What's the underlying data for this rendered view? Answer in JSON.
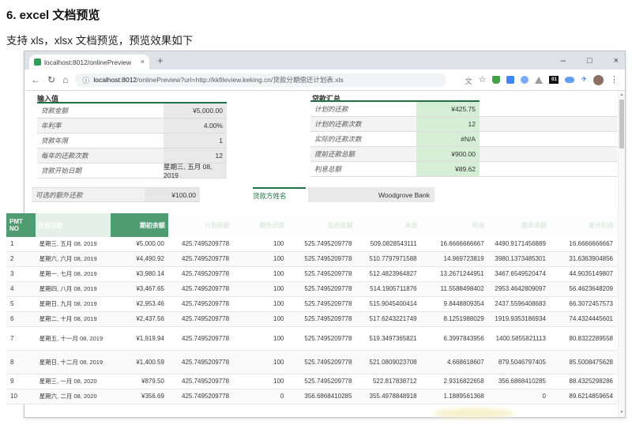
{
  "doc": {
    "title": "6. excel 文档预览",
    "subtitle": "支持 xls，xlsx 文档预览，预览效果如下"
  },
  "browser": {
    "tab_title": "localhost:8012/onlinePreview",
    "url_host": "localhost:8012",
    "url_rest": "/onlinePreview?url=http://kkfileview.keking.cn/贷款分期偿还计划表.xls",
    "extension_badge": "01"
  },
  "icons": {
    "back": "←",
    "refresh": "↻",
    "home": "⌂",
    "info": "ⓘ",
    "star": "☆",
    "translate": "文",
    "bird": "✈",
    "menu": "⋮",
    "minimize": "–",
    "maximize": "□",
    "close": "×",
    "tab_close": "×",
    "new_tab": "+",
    "scroll_up": "▲",
    "scroll_down": "▼"
  },
  "input_table": {
    "header": "输入值",
    "rows": [
      {
        "label": "贷款金额",
        "value": "¥5,000.00"
      },
      {
        "label": "年利率",
        "value": "4.00%"
      },
      {
        "label": "贷款年限",
        "value": "1"
      },
      {
        "label": "每年的还款次数",
        "value": "12"
      },
      {
        "label": "贷款开始日期",
        "value": "星期三, 五月 08, 2019"
      }
    ],
    "extra": {
      "label": "可选的额外还款",
      "value": "¥100.00"
    }
  },
  "summary_table": {
    "header": "贷款汇总",
    "rows": [
      {
        "label": "计划的还款",
        "value": "¥425.75"
      },
      {
        "label": "计划的还款次数",
        "value": "12"
      },
      {
        "label": "实际的还款次数",
        "value": "#N/A"
      },
      {
        "label": "提前还款总额",
        "value": "¥900.00"
      },
      {
        "label": "利息总额",
        "value": "¥89.62"
      }
    ],
    "extra": {
      "label": "贷款方姓名",
      "value": "Woodgrove Bank"
    }
  },
  "schedule": {
    "columns": [
      {
        "label": "PMT NO",
        "variant": "green"
      },
      {
        "label": "还款日期",
        "variant": "tint"
      },
      {
        "label": "期初余额",
        "variant": "green"
      },
      {
        "label": "计划还款",
        "variant": "ghost"
      },
      {
        "label": "额外还款",
        "variant": "ghost"
      },
      {
        "label": "总还款额",
        "variant": "ghost"
      },
      {
        "label": "本金",
        "variant": "ghost"
      },
      {
        "label": "利息",
        "variant": "ghost"
      },
      {
        "label": "期末余额",
        "variant": "ghost"
      },
      {
        "label": "累计利息",
        "variant": "ghost"
      }
    ],
    "rows": [
      [
        "1",
        "星期三, 五月 08, 2019",
        "¥5,000.00",
        "425.7495209778",
        "100",
        "525.7495209778",
        "509.0828543111",
        "16.6666666667",
        "4490.9171456889",
        "16.6666666667"
      ],
      [
        "2",
        "星期六, 六月 08, 2019",
        "¥4,490.92",
        "425.7495209778",
        "100",
        "525.7495209778",
        "510.7797971588",
        "14.969723819",
        "3980.1373485301",
        "31.6363904856"
      ],
      [
        "3",
        "星期一, 七月 08, 2019",
        "¥3,980.14",
        "425.7495209778",
        "100",
        "525.7495209778",
        "512.4823964827",
        "13.2671244951",
        "3467.6549520474",
        "44.9035149807"
      ],
      [
        "4",
        "星期四, 八月 08, 2019",
        "¥3,467.65",
        "425.7495209778",
        "100",
        "525.7495209778",
        "514.1905711876",
        "11.5588498402",
        "2953.4642809097",
        "56.4623648209"
      ],
      [
        "5",
        "星期日, 九月 08, 2019",
        "¥2,953.46",
        "425.7495209778",
        "100",
        "525.7495209778",
        "515.9045400414",
        "9.8448809354",
        "2437.5596408683",
        "66.3072457573"
      ],
      [
        "6",
        "星期二, 十月 08, 2019",
        "¥2,437.56",
        "425.7495209778",
        "100",
        "525.7495209778",
        "517.6243221749",
        "8.1251988029",
        "1919.9353186934",
        "74.4324445601"
      ],
      [
        "7",
        "星期五, 十一月 08, 2019",
        "¥1,919.94",
        "425.7495209778",
        "100",
        "525.7495209778",
        "519.3497365821",
        "6.3997843956",
        "1400.5855821113",
        "80.8322289558"
      ],
      [
        "8",
        "星期日, 十二月 08, 2019",
        "¥1,400.59",
        "425.7495209778",
        "100",
        "525.7495209778",
        "521.0809023708",
        "4.668618607",
        "879.5046797405",
        "85.5008475628"
      ],
      [
        "9",
        "星期三, 一月 08, 2020",
        "¥879.50",
        "425.7495209778",
        "100",
        "525.7495209778",
        "522.817838712",
        "2.9316822658",
        "356.6868410285",
        "88.4325298286"
      ],
      [
        "10",
        "星期六, 二月 08, 2020",
        "¥356.69",
        "425.7495209778",
        "0",
        "356.6868410285",
        "355.4978848918",
        "1.1889561368",
        "0",
        "89.6214859654"
      ]
    ]
  },
  "colors": {
    "excel_green": "#217346",
    "table_header_green": "#4f9c72",
    "summary_value_bg": "#d6eed6",
    "value_cell_bg": "#e9e9e9",
    "titlebar": "#dee1e6",
    "urlbar": "#f1f3f4"
  }
}
